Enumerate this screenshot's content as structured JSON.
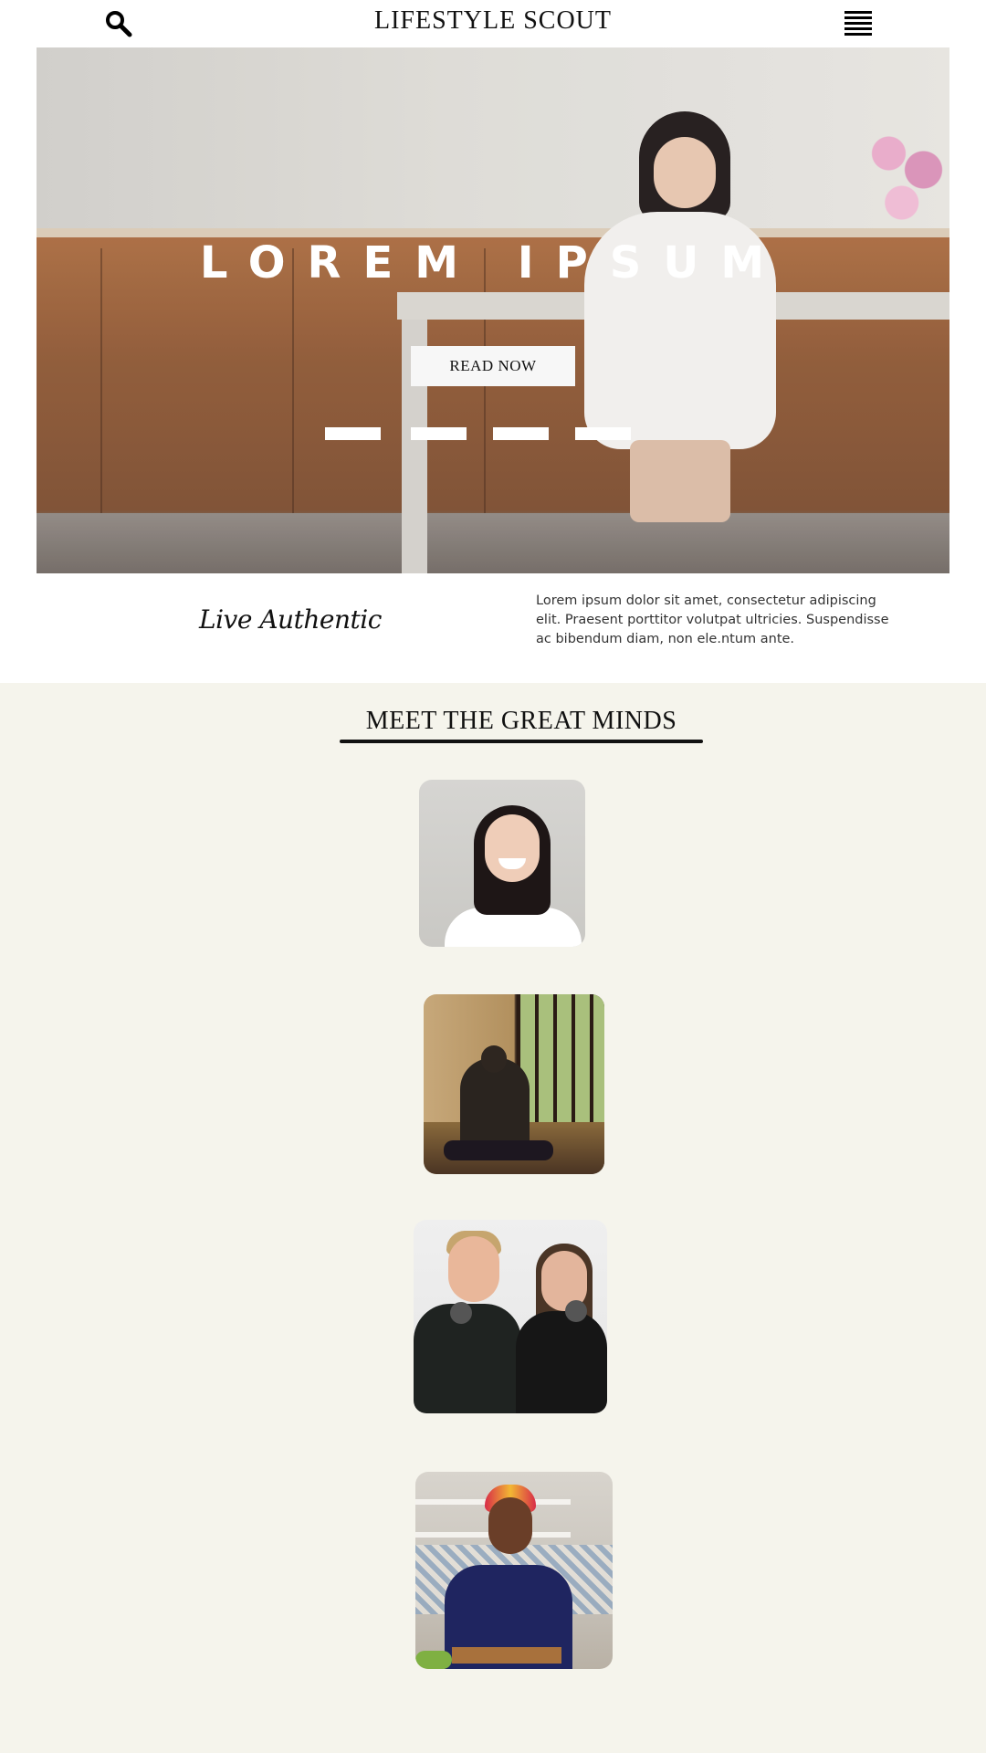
{
  "header": {
    "title": "LIFESTYLE SCOUT",
    "search_icon": "search-icon",
    "menu_icon": "hamburger-menu-icon"
  },
  "hero": {
    "headline": "LOREM IPSUM",
    "button_label": "READ NOW",
    "slide_indicators": 4,
    "active_slide": 1
  },
  "intro": {
    "tagline": "Live Authentic",
    "text": "Lorem ipsum dolor sit amet, consectetur adipiscing elit. Praesent porttitor volutpat ultricies. Suspendisse ac bibendum diam, non ele.ntum ante."
  },
  "minds": {
    "title": "MEET THE GREAT MINDS",
    "cards": [
      {
        "image": "portrait-smiling-woman"
      },
      {
        "image": "meditating-monk"
      },
      {
        "image": "two-men-with-microphones"
      },
      {
        "image": "woman-cooking-in-kitchen"
      }
    ]
  },
  "colors": {
    "section_bg": "#f5f4ec",
    "text": "#111111",
    "button_bg": "#f7f7f7",
    "accent_rule": "#111111"
  }
}
